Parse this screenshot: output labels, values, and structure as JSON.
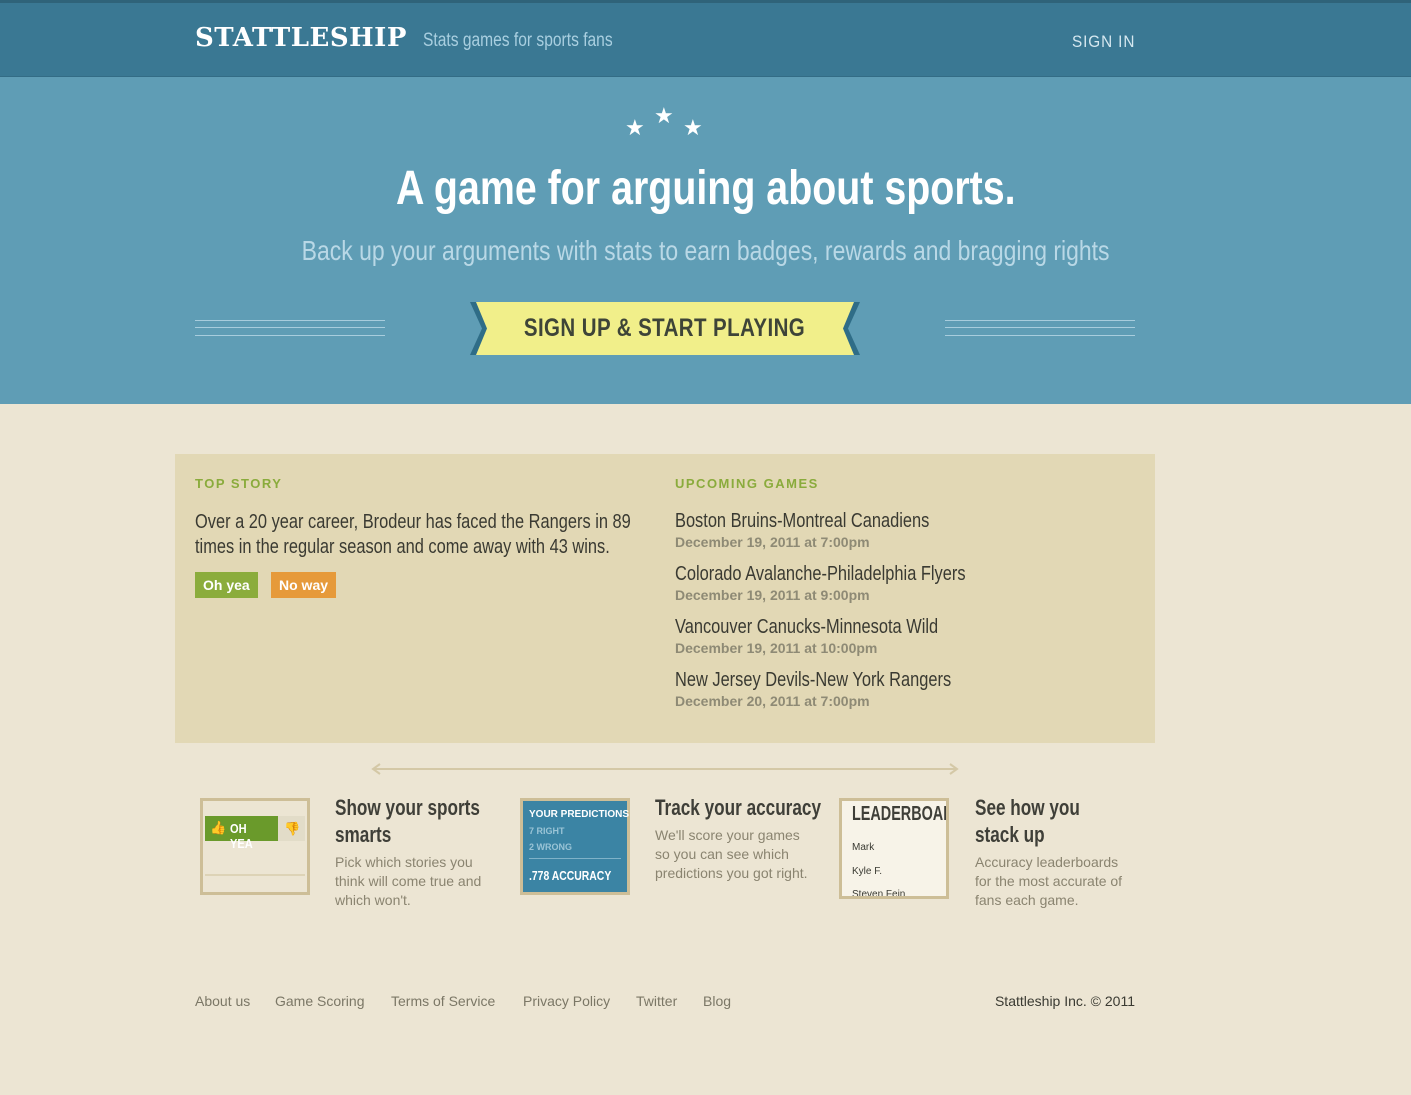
{
  "header": {
    "logo": "STATTLESHIP",
    "tagline": "Stats games for sports fans",
    "signin": "SIGN IN"
  },
  "hero": {
    "title": "A game for arguing about sports.",
    "subtitle": "Back up your arguments with stats to earn badges, rewards and bragging rights",
    "cta": "SIGN UP & START PLAYING"
  },
  "top_story": {
    "heading": "TOP STORY",
    "text": "Over a 20 year career, Brodeur has faced the Rangers in 89 times in the regular season and come away with 43 wins.",
    "yes_label": "Oh yea",
    "no_label": "No way"
  },
  "upcoming": {
    "heading": "UPCOMING GAMES",
    "games": [
      {
        "title": "Boston Bruins-Montreal Canadiens",
        "date": "December 19, 2011 at 7:00pm"
      },
      {
        "title": "Colorado Avalanche-Philadelphia Flyers",
        "date": "December 19, 2011 at 9:00pm"
      },
      {
        "title": "Vancouver Canucks-Minnesota Wild",
        "date": "December 19, 2011 at 10:00pm"
      },
      {
        "title": "New Jersey Devils-New York Rangers",
        "date": "December 20, 2011 at 7:00pm"
      }
    ]
  },
  "features": [
    {
      "title_line1": "Show your sports",
      "title_line2": "smarts",
      "desc_line1": "Pick which stories you",
      "desc_line2": "think will come true and",
      "desc_line3": "which won't.",
      "thumb_label": "OH YEA"
    },
    {
      "title_line1": "Track your accuracy",
      "title_line2": "",
      "desc_line1": "We'll score your games",
      "desc_line2": "so you can see which",
      "desc_line3": "predictions you got right.",
      "thumb_header": "YOUR PREDICTIONS",
      "thumb_right": "7 RIGHT",
      "thumb_wrong": "2 WRONG",
      "thumb_accuracy": ".778 ACCURACY"
    },
    {
      "title_line1": "See how you",
      "title_line2": "stack up",
      "desc_line1": "Accuracy leaderboards",
      "desc_line2": "for the most accurate of",
      "desc_line3": "fans each game.",
      "thumb_header": "LEADERBOAR",
      "thumb_names": [
        "Mark",
        "Kyle F.",
        "Steven Fein"
      ]
    }
  ],
  "footer": {
    "links": [
      "About us",
      "Game Scoring",
      "Terms of Service",
      "Privacy Policy",
      "Twitter",
      "Blog"
    ],
    "copyright": "Stattleship Inc. © 2011"
  },
  "colors": {
    "nav": "#3a7893",
    "hero": "#5f9db5",
    "cta": "#f1ef8a",
    "accent_green": "#8bac3c",
    "accent_orange": "#e69a3a",
    "panel": "#e2d8b5",
    "page": "#ece5d3"
  }
}
